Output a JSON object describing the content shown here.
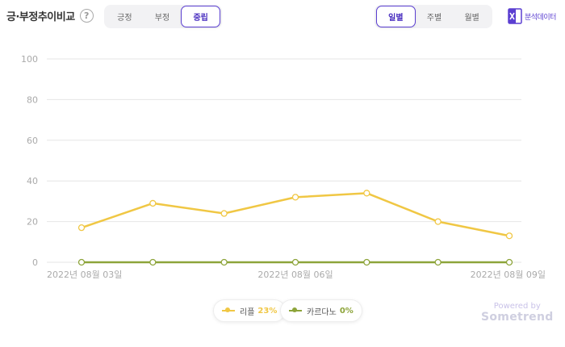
{
  "header": {
    "title": "긍·부정추이비교",
    "help_icon": "?",
    "sentiment_tabs": [
      {
        "label": "긍정",
        "active": false
      },
      {
        "label": "부정",
        "active": false
      },
      {
        "label": "중립",
        "active": true
      }
    ],
    "period_tabs": [
      {
        "label": "일별",
        "active": true
      },
      {
        "label": "주별",
        "active": false
      },
      {
        "label": "월별",
        "active": false
      }
    ],
    "export_label": "분석데이터",
    "export_icon": "excel-file-icon"
  },
  "colors": {
    "accent": "#5b3fd1",
    "series1": "#f0c744",
    "series2": "#8da43a",
    "grid": "#e6e6e6"
  },
  "chart_data": {
    "type": "line",
    "x": [
      "2022-08-03",
      "2022-08-04",
      "2022-08-05",
      "2022-08-06",
      "2022-08-07",
      "2022-08-08",
      "2022-08-09"
    ],
    "xtick_labels": [
      {
        "index": 0,
        "label": "2022년 08월 03일"
      },
      {
        "index": 3,
        "label": "2022년 08월 06일"
      },
      {
        "index": 6,
        "label": "2022년 08월 09일"
      }
    ],
    "yticks": [
      0,
      20,
      40,
      60,
      80,
      100
    ],
    "ylim": [
      0,
      100
    ],
    "grid": true,
    "legend_position": "bottom",
    "series": [
      {
        "name": "리플",
        "percent": "23%",
        "color": "#f0c744",
        "values": [
          17,
          29,
          24,
          32,
          34,
          20,
          13
        ]
      },
      {
        "name": "카르다노",
        "percent": "0%",
        "color": "#8da43a",
        "values": [
          0,
          0,
          0,
          0,
          0,
          0,
          0
        ]
      }
    ]
  },
  "footer": {
    "powered_by": "Powered by",
    "brand": "Sometrend"
  }
}
